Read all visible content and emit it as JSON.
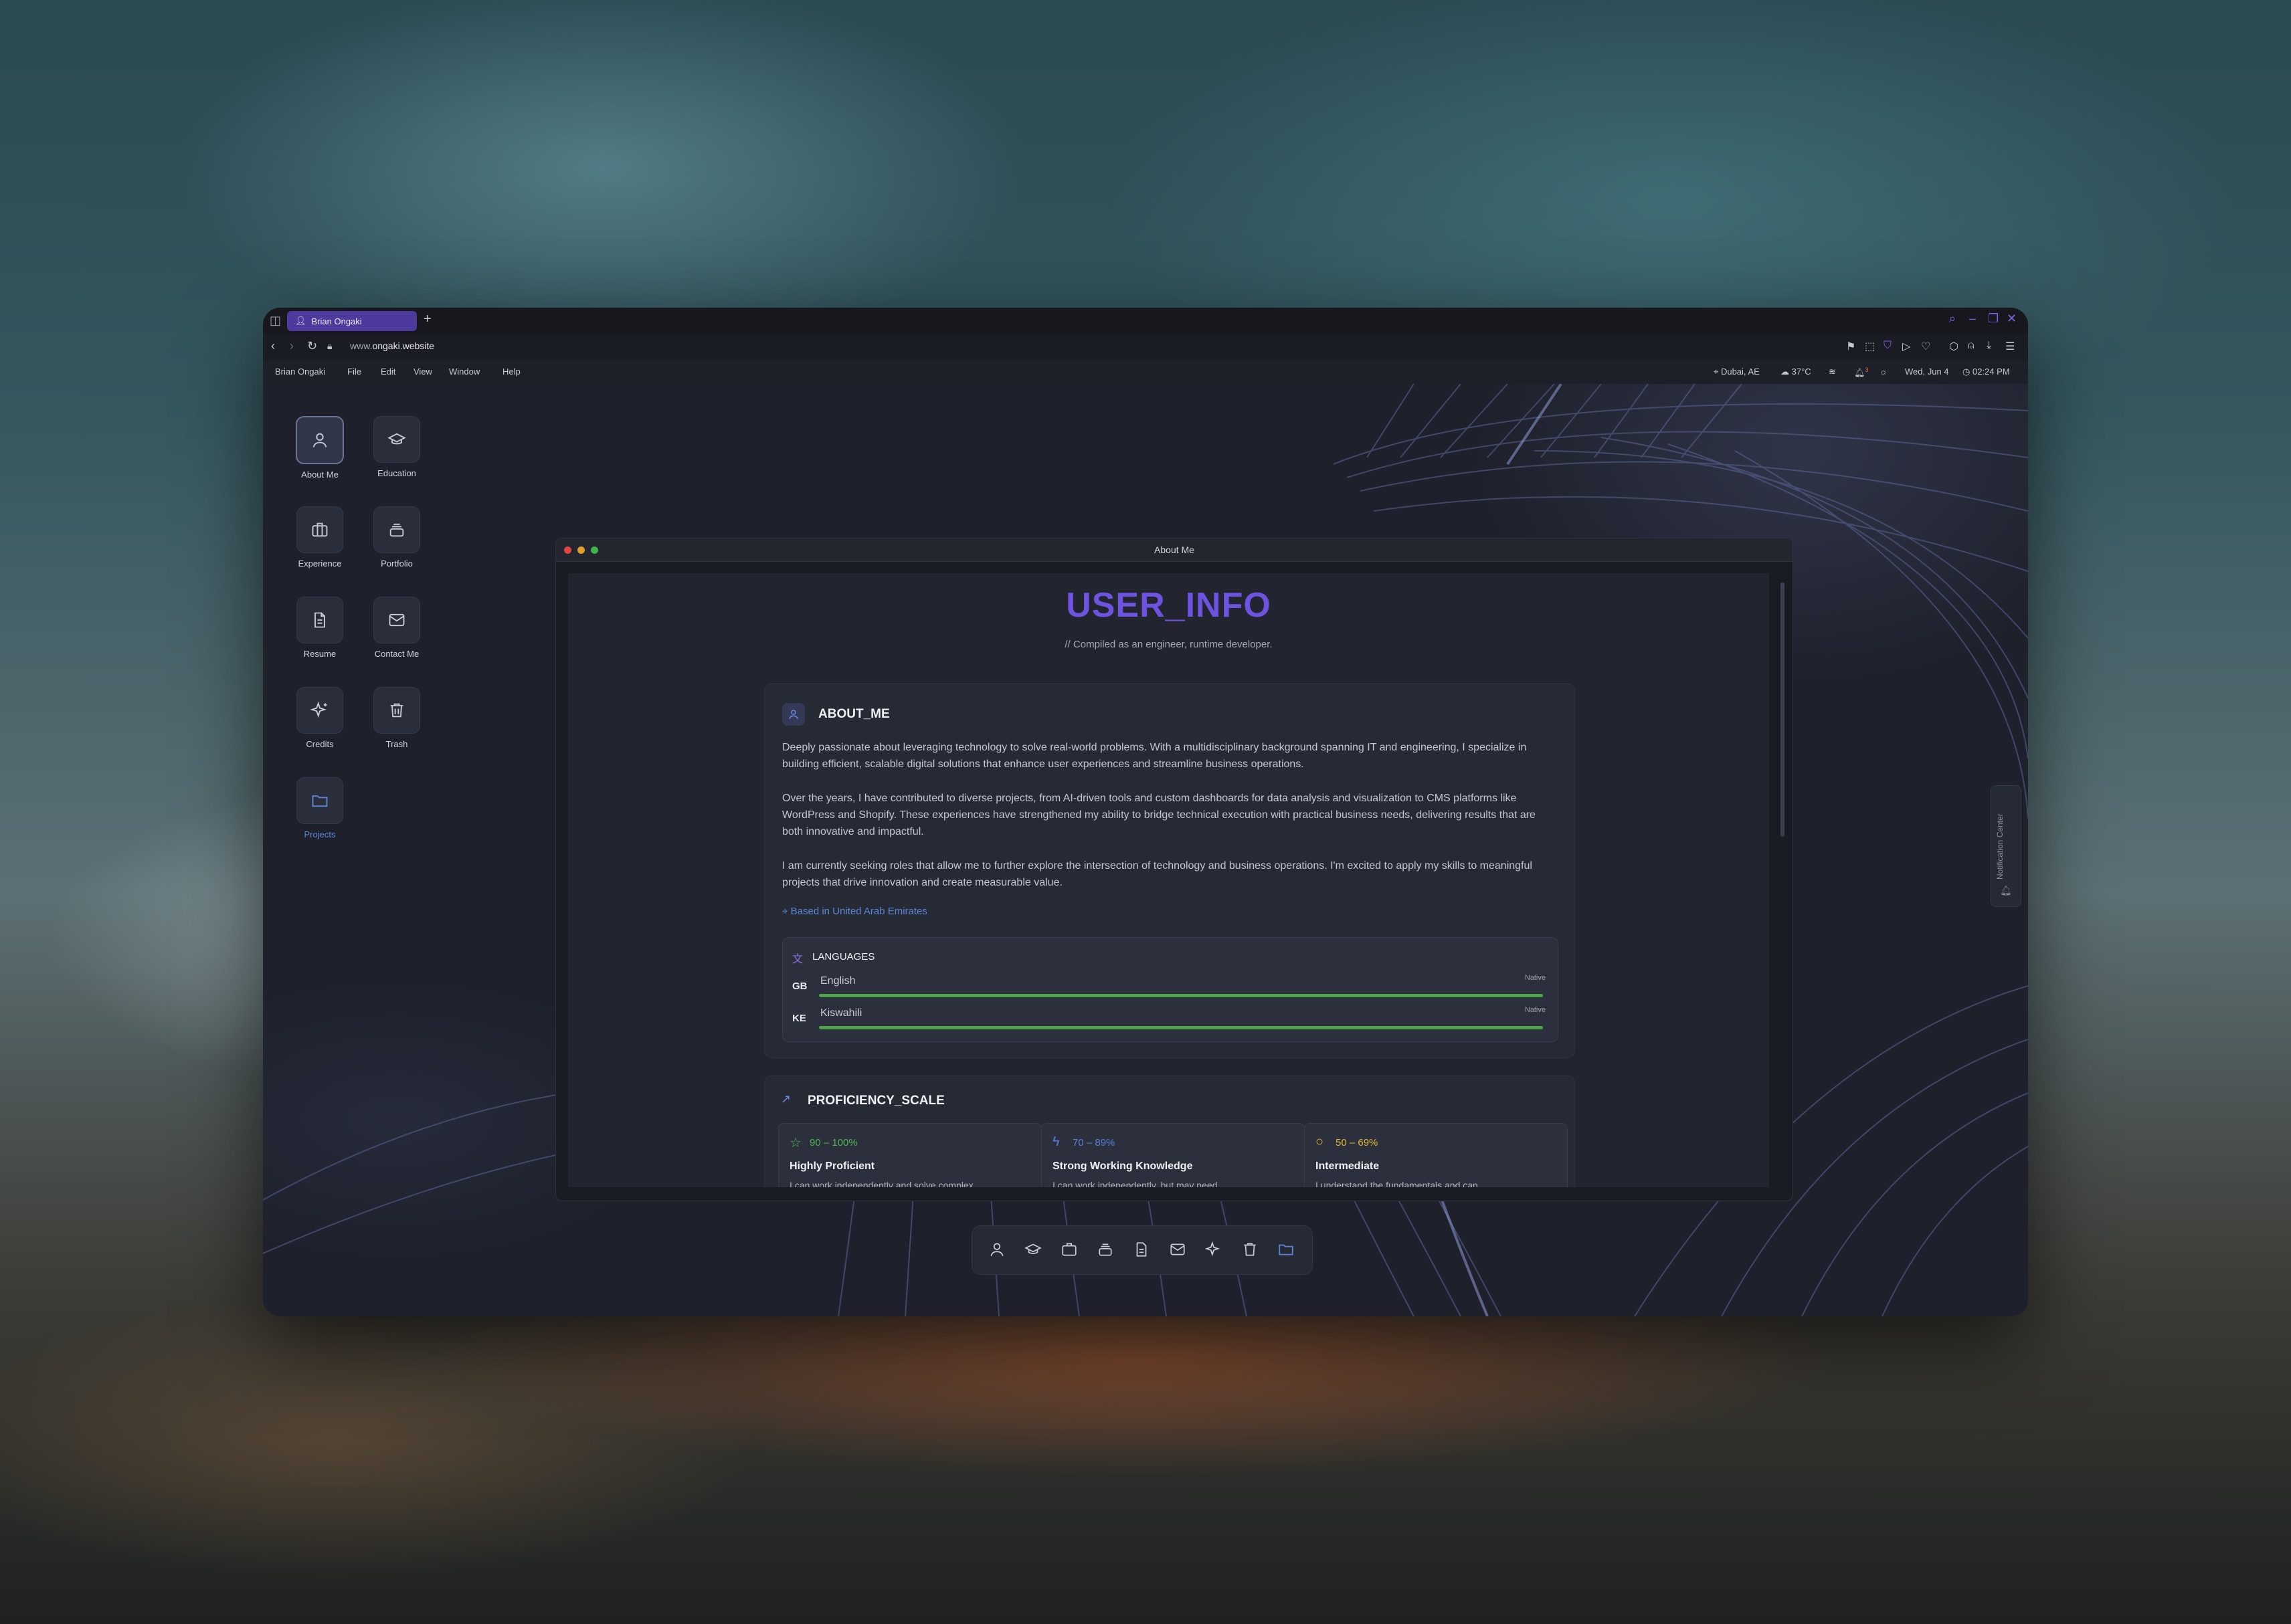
{
  "browser": {
    "tab_title": "Brian Ongaki",
    "new_tab": "+",
    "url_prefix": "www.",
    "url_domain": "ongaki.website"
  },
  "menubar": {
    "app_name": "Brian Ongaki",
    "items": [
      "File",
      "Edit",
      "View",
      "Window",
      "Help"
    ],
    "location": "Dubai, AE",
    "weather": "37°C",
    "notification_count": "3",
    "date": "Wed, Jun 4",
    "time": "02:24 PM"
  },
  "desktop_icons": [
    {
      "label": "About Me",
      "icon": "user-icon"
    },
    {
      "label": "Education",
      "icon": "graduation-cap-icon"
    },
    {
      "label": "Experience",
      "icon": "briefcase-icon"
    },
    {
      "label": "Portfolio",
      "icon": "stack-icon"
    },
    {
      "label": "Resume",
      "icon": "document-icon"
    },
    {
      "label": "Contact Me",
      "icon": "mail-icon"
    },
    {
      "label": "Credits",
      "icon": "sparkles-icon"
    },
    {
      "label": "Trash",
      "icon": "trash-icon"
    },
    {
      "label": "Projects",
      "icon": "folder-icon"
    }
  ],
  "window": {
    "title": "About Me",
    "heading": "USER_INFO",
    "subtitle": "// Compiled as an engineer, runtime developer.",
    "about_title": "ABOUT_ME",
    "paragraphs": [
      "Deeply passionate about leveraging technology to solve real-world problems. With a multidisciplinary background spanning IT and engineering, I specialize in building efficient, scalable digital solutions that enhance user experiences and streamline business operations.",
      "Over the years, I have contributed to diverse projects, from AI-driven tools and custom dashboards for data analysis and visualization to CMS platforms like WordPress and Shopify. These experiences have strengthened my ability to bridge technical execution with practical business needs, delivering results that are both innovative and impactful.",
      "I am currently seeking roles that allow me to further explore the intersection of technology and business operations. I'm excited to apply my skills to meaningful projects that drive innovation and create measurable value."
    ],
    "location": "Based in United Arab Emirates",
    "languages_title": "LANGUAGES",
    "languages": [
      {
        "code": "GB",
        "name": "English",
        "level": "Native",
        "fill": 1.0
      },
      {
        "code": "KE",
        "name": "Kiswahili",
        "level": "Native",
        "fill": 1.0
      }
    ],
    "proficiency_title": "PROFICIENCY_SCALE",
    "proficiency": [
      {
        "range": "90 – 100%",
        "name": "Highly Proficient",
        "desc": "I can work independently and solve complex",
        "color": "#52b455"
      },
      {
        "range": "70 – 89%",
        "name": "Strong Working Knowledge",
        "desc": "I can work independently, but may need",
        "color": "#5b7fe0"
      },
      {
        "range": "50 – 69%",
        "name": "Intermediate",
        "desc": "I understand the fundamentals and can",
        "color": "#e0b832"
      }
    ]
  },
  "notification_center": "Notification Center",
  "colors": {
    "accent": "#6d53e0",
    "link": "#5c86d6",
    "bar": "#4fa245"
  }
}
